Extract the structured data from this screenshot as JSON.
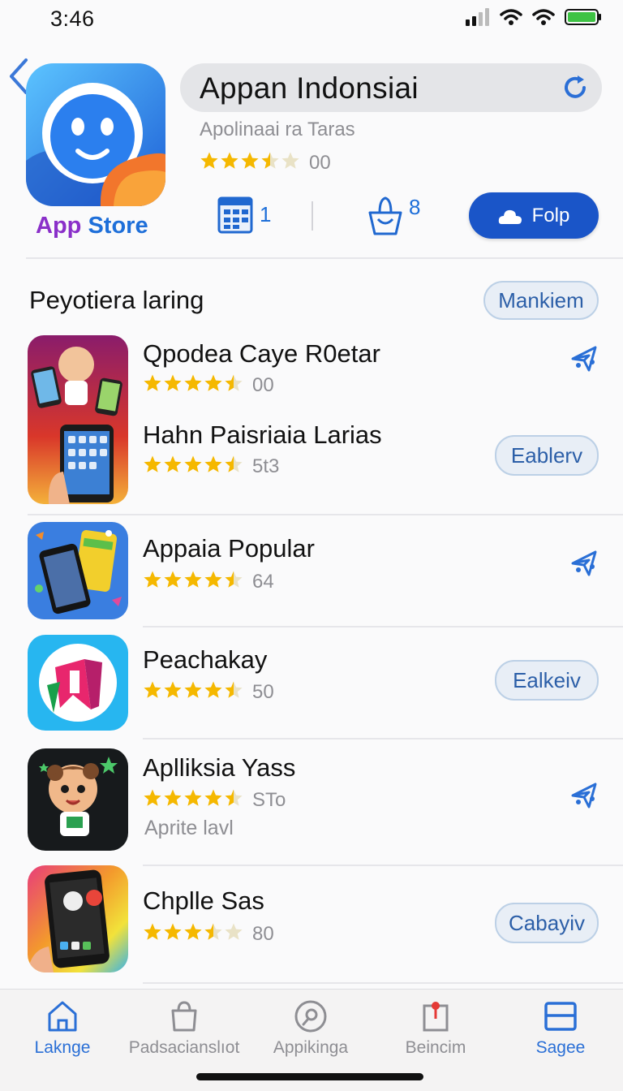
{
  "status_bar": {
    "time": "3:46"
  },
  "header": {
    "app_store_label_a": "App",
    "app_store_label_b": "Store",
    "title": "Appan Indonsiai",
    "subtitle": "Apolinaai ra Taras",
    "rating_stars": 3.5,
    "rating_count": "00",
    "stat_one": "1",
    "stat_two": "8",
    "follow_label": "Folp"
  },
  "section": {
    "title": "Peyotiera laring",
    "manage_label": "Mankiem"
  },
  "apps": [
    {
      "name": "Qpodea Caye R0etar",
      "stars": 4.5,
      "rating": "00"
    },
    {
      "name": "Hahn Paisriaia Larias",
      "stars": 4.5,
      "rating": "5t3",
      "button": "Eablerv"
    },
    {
      "name": "Appaia Popular",
      "stars": 4.5,
      "rating": "64"
    },
    {
      "name": "Peachakay",
      "stars": 4.5,
      "rating": "50",
      "button": "Ealkeiv"
    },
    {
      "name": "Aplliksia Yass",
      "stars": 4.5,
      "rating": "STo",
      "extra": "Aprite lavl"
    },
    {
      "name": "Chplle Sas",
      "stars": 3.5,
      "rating": "80",
      "button": "Cabayiv"
    }
  ],
  "tabs": [
    {
      "label": "Lakngе",
      "icon": "home-icon",
      "active": true
    },
    {
      "label": "Padsacianslıot",
      "icon": "bag-icon",
      "active": false
    },
    {
      "label": "Appikinga",
      "icon": "search-circle-icon",
      "active": false
    },
    {
      "label": "Beincim",
      "icon": "bookmark-icon",
      "active": false
    },
    {
      "label": "Sagee",
      "icon": "panel-icon",
      "active": true
    }
  ],
  "colors": {
    "accent": "#1a55c8",
    "star": "#f5b800",
    "muted": "#8e8e93"
  }
}
